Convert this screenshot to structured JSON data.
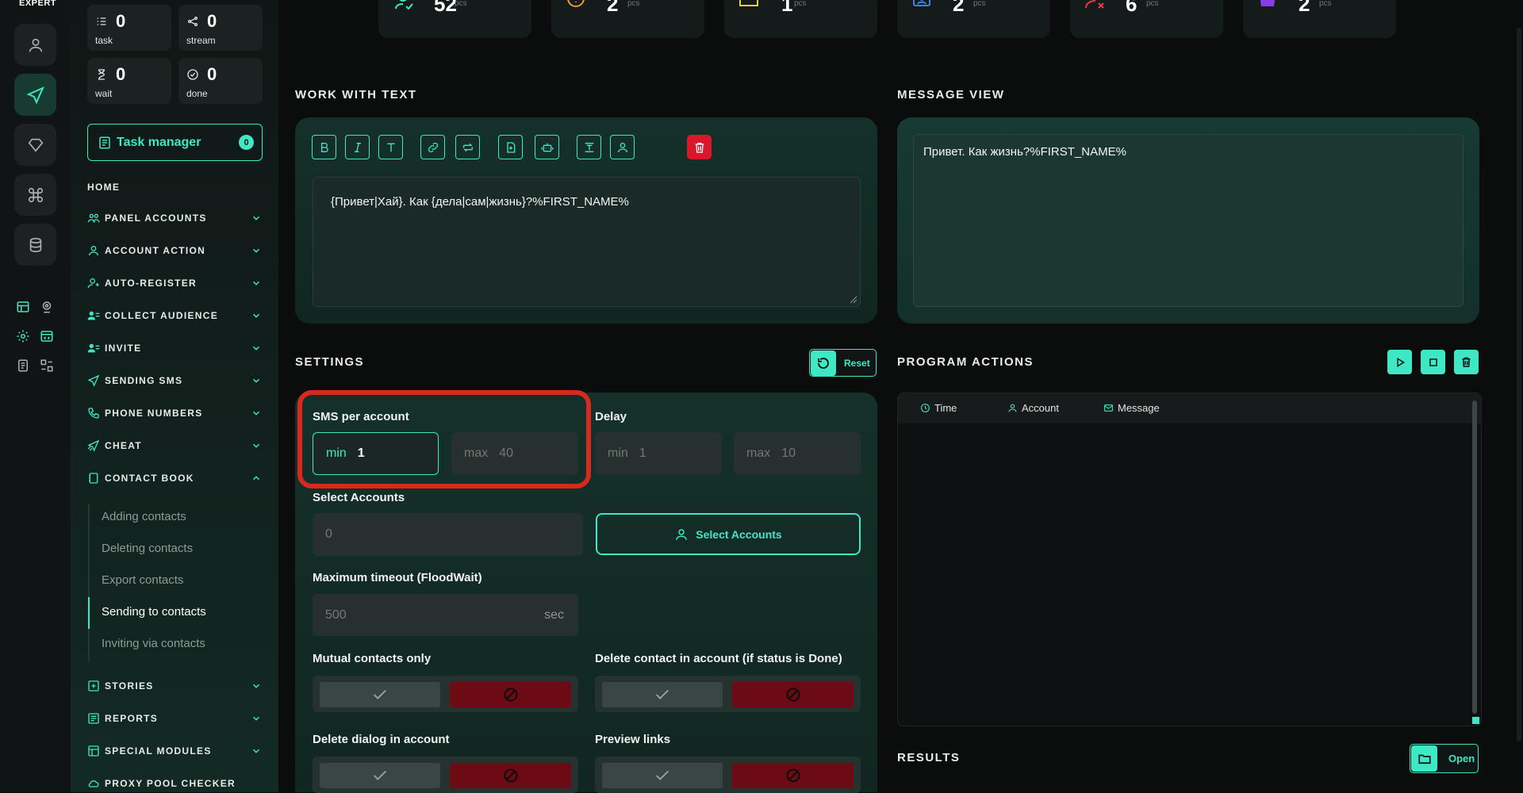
{
  "brand": "EXPERT",
  "stats": [
    {
      "value": "0",
      "label": "task"
    },
    {
      "value": "0",
      "label": "stream"
    },
    {
      "value": "0",
      "label": "wait"
    },
    {
      "value": "0",
      "label": "done"
    }
  ],
  "task_manager": {
    "label": "Task manager",
    "count": "0"
  },
  "nav": {
    "home": "HOME",
    "items": [
      "PANEL ACCOUNTS",
      "ACCOUNT ACTION",
      "AUTO-REGISTER",
      "COLLECT AUDIENCE",
      "INVITE",
      "SENDING SMS",
      "PHONE NUMBERS",
      "CHEAT",
      "CONTACT BOOK"
    ],
    "contact_book_sub": [
      "Adding contacts",
      "Deleting contacts",
      "Export contacts",
      "Sending to contacts",
      "Inviting via contacts"
    ],
    "after": [
      "STORIES",
      "REPORTS",
      "SPECIAL MODULES",
      "PROXY POOL CHECKER"
    ]
  },
  "top_cards": [
    {
      "value": "52",
      "unit": "pcs",
      "icon": "user-online-icon"
    },
    {
      "value": "2",
      "unit": "pcs",
      "icon": "warning-icon"
    },
    {
      "value": "1",
      "unit": "pcs",
      "icon": "folder-icon"
    },
    {
      "value": "2",
      "unit": "pcs",
      "icon": "id-card-icon"
    },
    {
      "value": "6",
      "unit": "pcs",
      "icon": "user-blocked-icon"
    },
    {
      "value": "2",
      "unit": "pcs",
      "icon": "crown-icon"
    }
  ],
  "work_with_text": {
    "title": "WORK WITH TEXT",
    "text": "{Привет|Хай}. Как {дела|сам|жизнь}?%FIRST_NAME%"
  },
  "message_view": {
    "title": "MESSAGE VIEW",
    "text": "Привет. Как жизнь?%FIRST_NAME%"
  },
  "settings": {
    "title": "SETTINGS",
    "reset": "Reset",
    "sms_per_account": {
      "label": "SMS per account",
      "min_label": "min",
      "min": "1",
      "max_label": "max",
      "max": "40"
    },
    "delay": {
      "label": "Delay",
      "min_label": "min",
      "min": "1",
      "max_label": "max",
      "max": "10"
    },
    "select_accounts": {
      "label": "Select Accounts",
      "value": "0",
      "button": "Select Accounts"
    },
    "timeout": {
      "label": "Maximum timeout (FloodWait)",
      "value": "500",
      "unit": "sec"
    },
    "mutual": "Mutual contacts only",
    "delete_contact": "Delete contact in account (if status is Done)",
    "delete_dialog": "Delete dialog in account",
    "preview_links": "Preview links"
  },
  "program_actions": {
    "title": "PROGRAM ACTIONS",
    "columns": [
      "Time",
      "Account",
      "Message"
    ]
  },
  "results": {
    "title": "RESULTS",
    "open": "Open"
  },
  "colors": {
    "accent": "#3ee8c4",
    "danger": "#d8172b",
    "highlight": "#d8291f"
  }
}
